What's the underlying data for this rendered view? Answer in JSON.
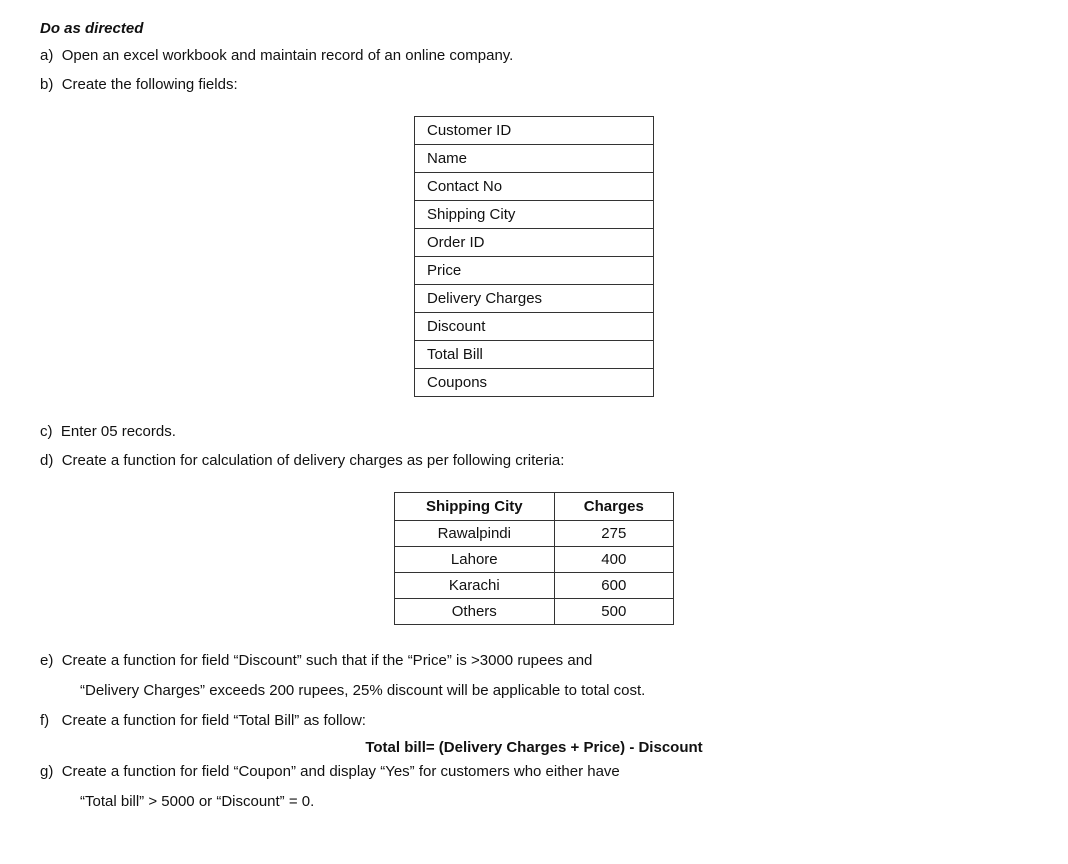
{
  "title": "Do as directed",
  "instructions": {
    "a": "Open an excel workbook and maintain record of an online company.",
    "b": "Create the following fields:",
    "c": "Enter 05 records.",
    "d": "Create a function for calculation of delivery charges as per following criteria:",
    "e_line1": "Create a function for field “Discount” such that if the “Price” is >3000 rupees and",
    "e_line2": "“Delivery Charges” exceeds 200 rupees, 25% discount will be applicable to total cost.",
    "f_line1": "Create a function for field “Total Bill” as follow:",
    "f_formula": "Total bill= (Delivery Charges + Price) - Discount",
    "g_line1": "Create a function for field “Coupon” and display “Yes” for customers who either have",
    "g_line2": "“Total bill” > 5000 or “Discount” = 0."
  },
  "fields_table": {
    "rows": [
      "Customer ID",
      "Name",
      "Contact No",
      "Shipping City",
      "Order ID",
      "Price",
      "Delivery Charges",
      "Discount",
      "Total Bill",
      "Coupons"
    ]
  },
  "shipping_table": {
    "headers": [
      "Shipping City",
      "Charges"
    ],
    "rows": [
      {
        "city": "Rawalpindi",
        "charges": "275"
      },
      {
        "city": "Lahore",
        "charges": "400"
      },
      {
        "city": "Karachi",
        "charges": "600"
      },
      {
        "city": "Others",
        "charges": "500"
      }
    ]
  }
}
